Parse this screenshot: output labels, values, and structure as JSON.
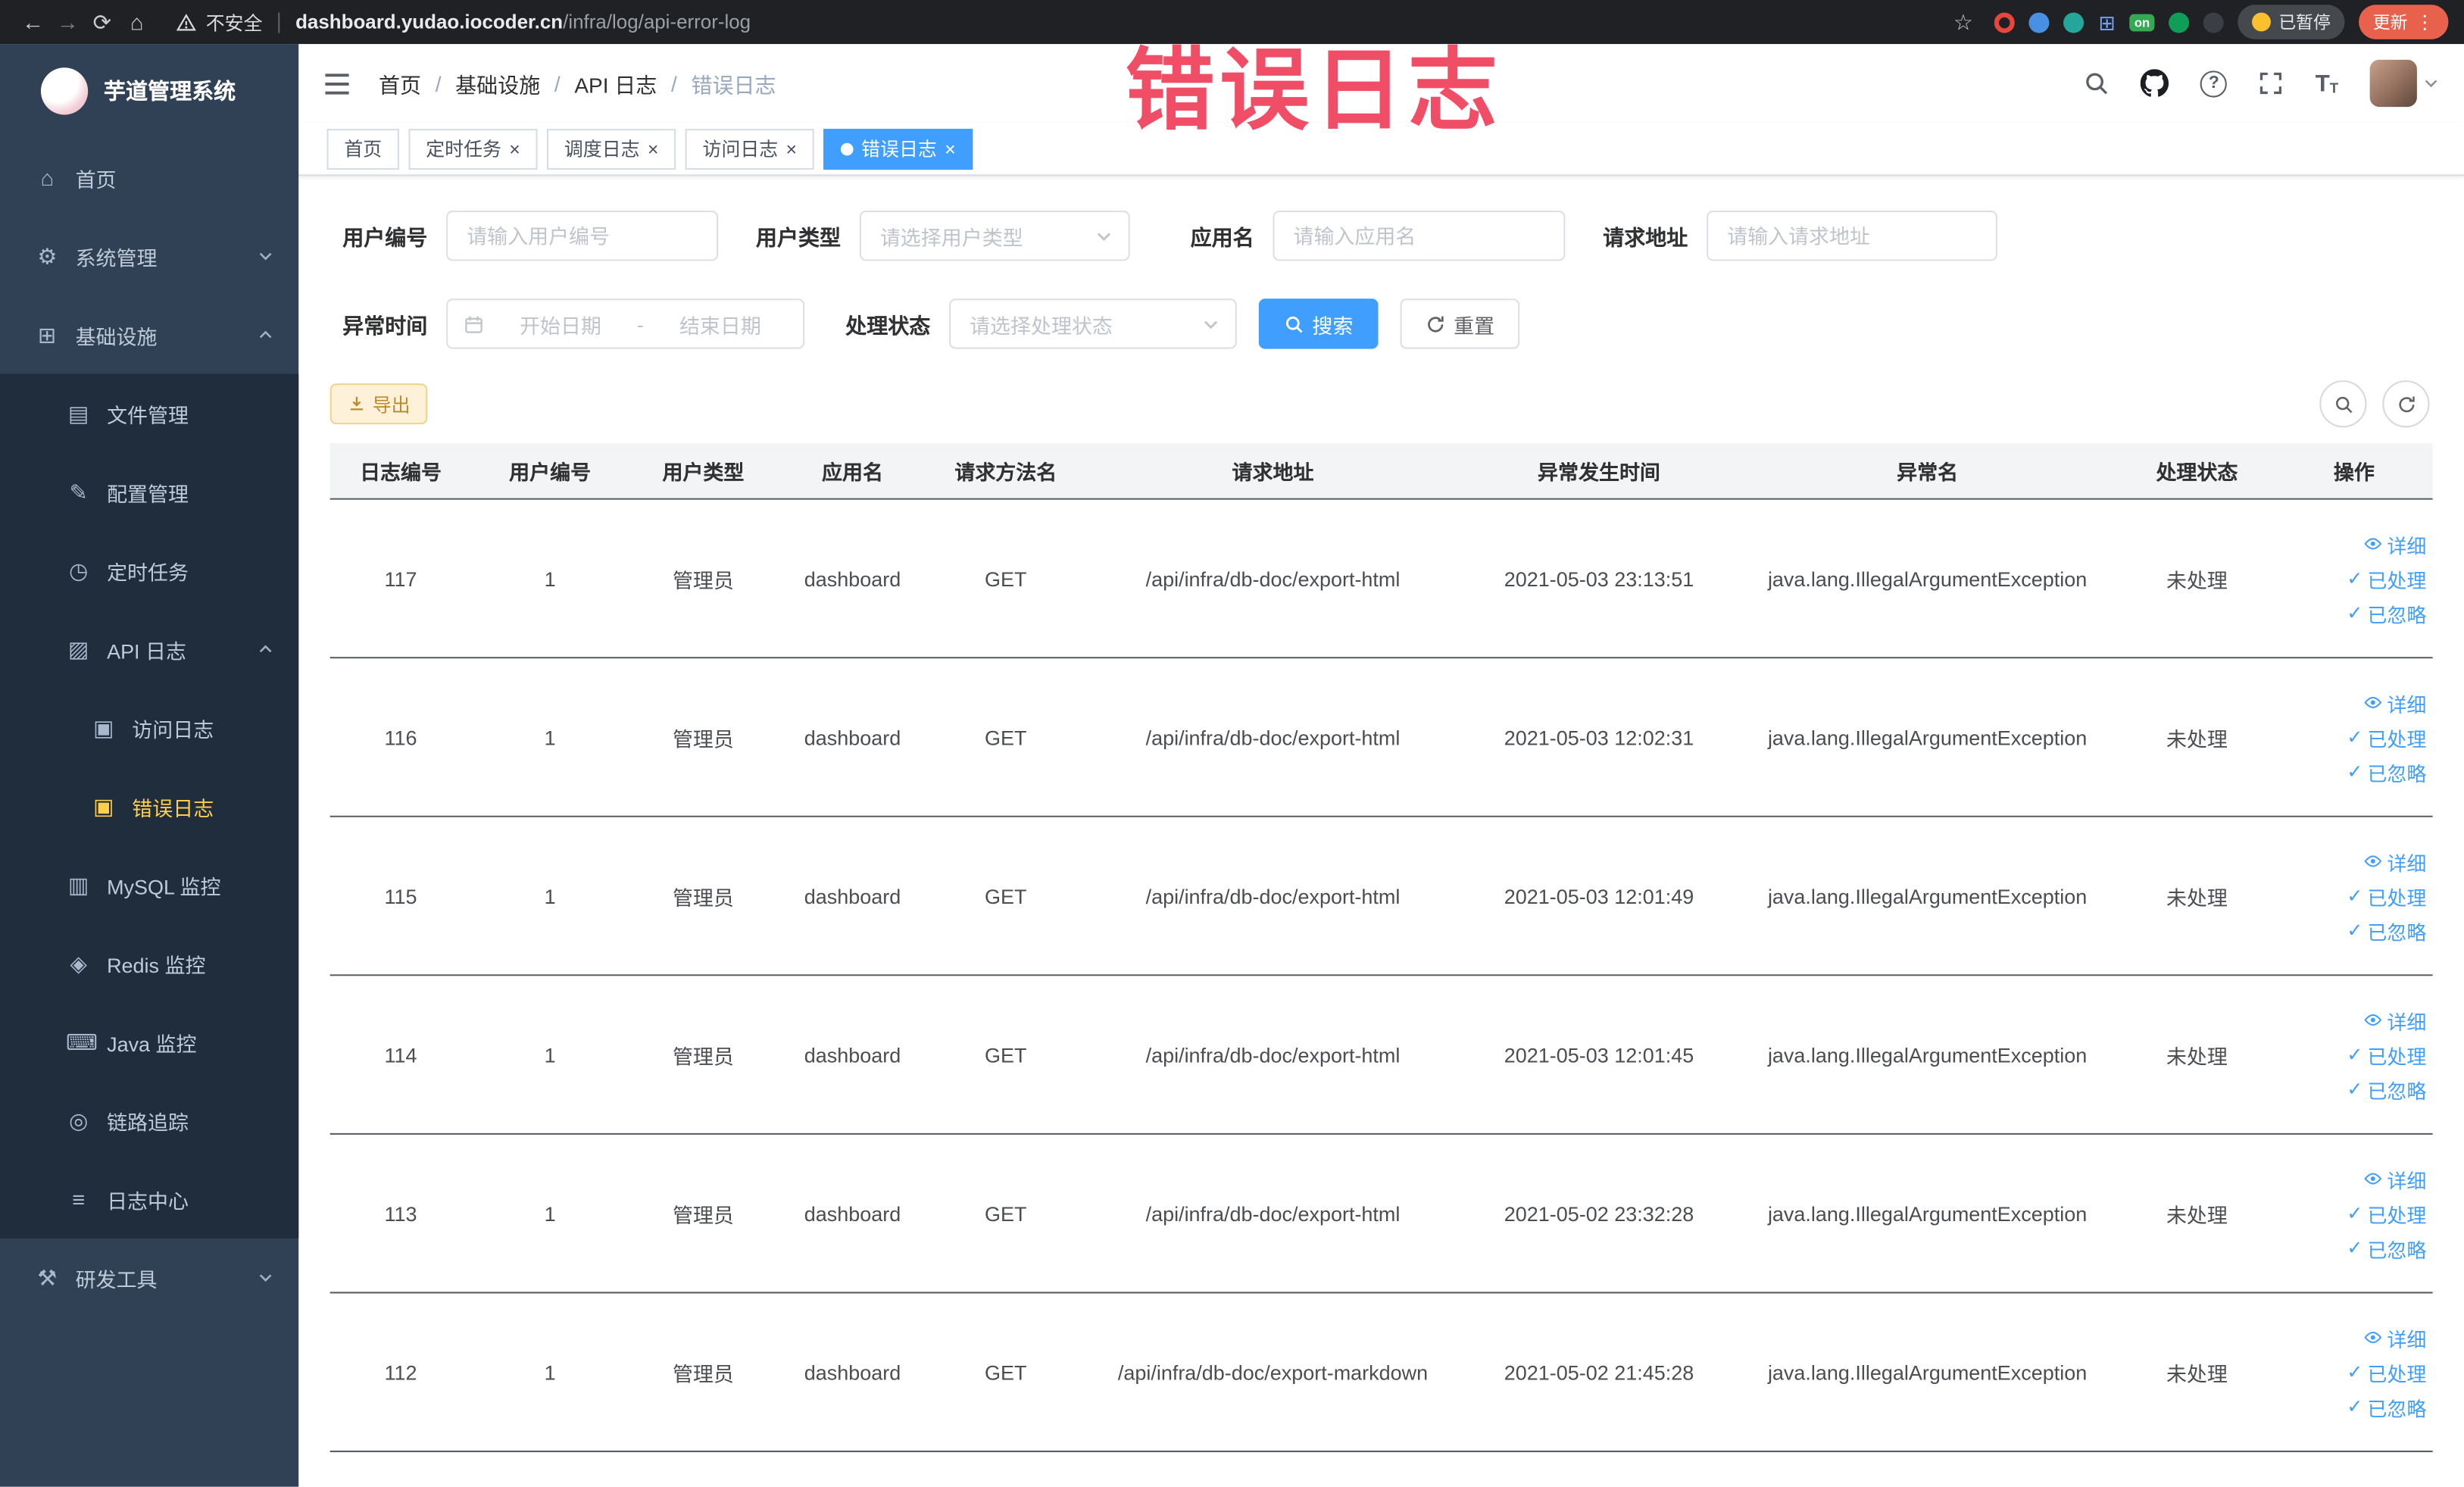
{
  "watermark": "错误日志",
  "colors": {
    "accent": "#409eff",
    "sidebar_bg": "#304156",
    "sidebar_submenu_bg": "#1f2d3d",
    "sidebar_active": "#ffd04b",
    "watermark": "#f04e66",
    "export_button": "#e6a23c",
    "chrome_bg": "#202124"
  },
  "browser": {
    "security_label": "不安全",
    "url_host": "dashboard.yudao.iocoder.cn",
    "url_path": "/infra/log/api-error-log",
    "paused_badge": "已暂停",
    "update_button": "更新"
  },
  "sidebar": {
    "app_title": "芋道管理系统",
    "items": [
      {
        "label": "首页",
        "icon": "home-icon",
        "level": 1
      },
      {
        "label": "系统管理",
        "icon": "gear-icon",
        "level": 1,
        "chevron": "down"
      },
      {
        "label": "基础设施",
        "icon": "infrastructure-icon",
        "level": 1,
        "chevron": "up"
      },
      {
        "label": "文件管理",
        "icon": "file-icon",
        "level": 2
      },
      {
        "label": "配置管理",
        "icon": "config-icon",
        "level": 2
      },
      {
        "label": "定时任务",
        "icon": "timer-icon",
        "level": 2
      },
      {
        "label": "API 日志",
        "icon": "api-log-icon",
        "level": 2,
        "chevron": "up"
      },
      {
        "label": "访问日志",
        "icon": "access-log-icon",
        "level": 3
      },
      {
        "label": "错误日志",
        "icon": "error-log-icon",
        "level": 3,
        "active": true
      },
      {
        "label": "MySQL 监控",
        "icon": "mysql-icon",
        "level": 2
      },
      {
        "label": "Redis 监控",
        "icon": "redis-icon",
        "level": 2
      },
      {
        "label": "Java 监控",
        "icon": "java-icon",
        "level": 2
      },
      {
        "label": "链路追踪",
        "icon": "trace-icon",
        "level": 2
      },
      {
        "label": "日志中心",
        "icon": "log-center-icon",
        "level": 2
      },
      {
        "label": "研发工具",
        "icon": "devtools-icon",
        "level": 1,
        "chevron": "down"
      }
    ]
  },
  "header": {
    "breadcrumb": [
      "首页",
      "基础设施",
      "API 日志",
      "错误日志"
    ],
    "breadcrumb_separator": "/"
  },
  "tabs": [
    {
      "label": "首页",
      "closable": false,
      "active": false
    },
    {
      "label": "定时任务",
      "closable": true,
      "active": false
    },
    {
      "label": "调度日志",
      "closable": true,
      "active": false
    },
    {
      "label": "访问日志",
      "closable": true,
      "active": false
    },
    {
      "label": "错误日志",
      "closable": true,
      "active": true
    }
  ],
  "filters": {
    "user_id": {
      "label": "用户编号",
      "placeholder": "请输入用户编号"
    },
    "user_type": {
      "label": "用户类型",
      "placeholder": "请选择用户类型"
    },
    "app_name": {
      "label": "应用名",
      "placeholder": "请输入应用名"
    },
    "request_url": {
      "label": "请求地址",
      "placeholder": "请输入请求地址"
    },
    "exception_time": {
      "label": "异常时间",
      "start_placeholder": "开始日期",
      "end_placeholder": "结束日期",
      "separator": "-"
    },
    "process_status": {
      "label": "处理状态",
      "placeholder": "请选择处理状态"
    },
    "search_button": "搜索",
    "reset_button": "重置"
  },
  "toolbar": {
    "export_button": "导出"
  },
  "table": {
    "columns": [
      "日志编号",
      "用户编号",
      "用户类型",
      "应用名",
      "请求方法名",
      "请求地址",
      "异常发生时间",
      "异常名",
      "处理状态",
      "操作"
    ],
    "actions": {
      "detail": "详细",
      "process": "已处理",
      "ignore": "已忽略"
    },
    "rows": [
      {
        "log_id": "117",
        "user_id": "1",
        "user_type": "管理员",
        "app_name": "dashboard",
        "method": "GET",
        "url": "/api/infra/db-doc/export-html",
        "time": "2021-05-03 23:13:51",
        "exception": "java.lang.IllegalArgumentException",
        "status": "未处理"
      },
      {
        "log_id": "116",
        "user_id": "1",
        "user_type": "管理员",
        "app_name": "dashboard",
        "method": "GET",
        "url": "/api/infra/db-doc/export-html",
        "time": "2021-05-03 12:02:31",
        "exception": "java.lang.IllegalArgumentException",
        "status": "未处理"
      },
      {
        "log_id": "115",
        "user_id": "1",
        "user_type": "管理员",
        "app_name": "dashboard",
        "method": "GET",
        "url": "/api/infra/db-doc/export-html",
        "time": "2021-05-03 12:01:49",
        "exception": "java.lang.IllegalArgumentException",
        "status": "未处理"
      },
      {
        "log_id": "114",
        "user_id": "1",
        "user_type": "管理员",
        "app_name": "dashboard",
        "method": "GET",
        "url": "/api/infra/db-doc/export-html",
        "time": "2021-05-03 12:01:45",
        "exception": "java.lang.IllegalArgumentException",
        "status": "未处理"
      },
      {
        "log_id": "113",
        "user_id": "1",
        "user_type": "管理员",
        "app_name": "dashboard",
        "method": "GET",
        "url": "/api/infra/db-doc/export-html",
        "time": "2021-05-02 23:32:28",
        "exception": "java.lang.IllegalArgumentException",
        "status": "未处理"
      },
      {
        "log_id": "112",
        "user_id": "1",
        "user_type": "管理员",
        "app_name": "dashboard",
        "method": "GET",
        "url": "/api/infra/db-doc/export-markdown",
        "time": "2021-05-02 21:45:28",
        "exception": "java.lang.IllegalArgumentException",
        "status": "未处理"
      }
    ]
  }
}
